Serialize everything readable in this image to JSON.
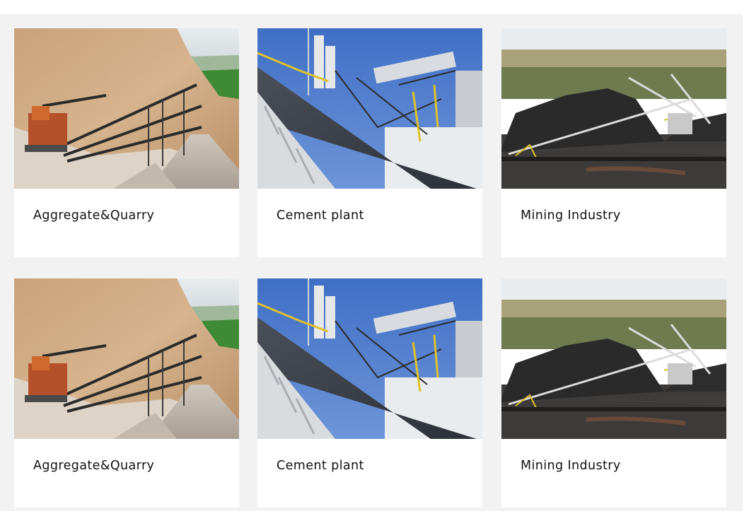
{
  "cards": [
    {
      "label": "Aggregate&Quarry",
      "image": "quarry-photo"
    },
    {
      "label": "Cement plant",
      "image": "cement-plant-photo"
    },
    {
      "label": "Mining Industry",
      "image": "mining-photo"
    },
    {
      "label": "Aggregate&Quarry",
      "image": "quarry-photo"
    },
    {
      "label": "Cement plant",
      "image": "cement-plant-photo"
    },
    {
      "label": "Mining Industry",
      "image": "mining-photo"
    }
  ]
}
